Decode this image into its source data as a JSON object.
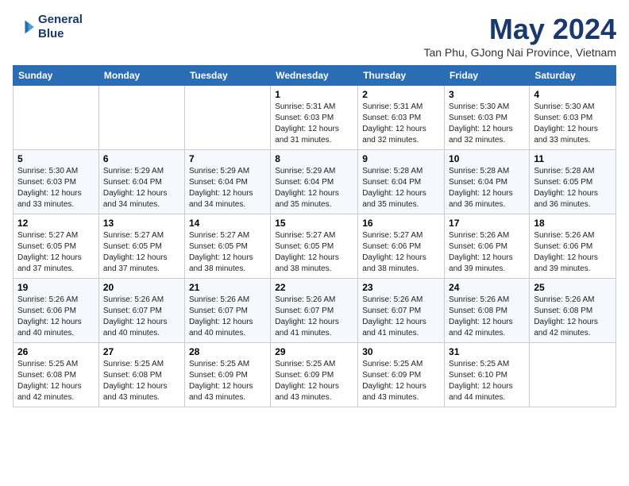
{
  "header": {
    "logo_line1": "General",
    "logo_line2": "Blue",
    "title": "May 2024",
    "subtitle": "Tan Phu, GJong Nai Province, Vietnam"
  },
  "weekdays": [
    "Sunday",
    "Monday",
    "Tuesday",
    "Wednesday",
    "Thursday",
    "Friday",
    "Saturday"
  ],
  "weeks": [
    [
      {
        "day": "",
        "info": ""
      },
      {
        "day": "",
        "info": ""
      },
      {
        "day": "",
        "info": ""
      },
      {
        "day": "1",
        "info": "Sunrise: 5:31 AM\nSunset: 6:03 PM\nDaylight: 12 hours\nand 31 minutes."
      },
      {
        "day": "2",
        "info": "Sunrise: 5:31 AM\nSunset: 6:03 PM\nDaylight: 12 hours\nand 32 minutes."
      },
      {
        "day": "3",
        "info": "Sunrise: 5:30 AM\nSunset: 6:03 PM\nDaylight: 12 hours\nand 32 minutes."
      },
      {
        "day": "4",
        "info": "Sunrise: 5:30 AM\nSunset: 6:03 PM\nDaylight: 12 hours\nand 33 minutes."
      }
    ],
    [
      {
        "day": "5",
        "info": "Sunrise: 5:30 AM\nSunset: 6:03 PM\nDaylight: 12 hours\nand 33 minutes."
      },
      {
        "day": "6",
        "info": "Sunrise: 5:29 AM\nSunset: 6:04 PM\nDaylight: 12 hours\nand 34 minutes."
      },
      {
        "day": "7",
        "info": "Sunrise: 5:29 AM\nSunset: 6:04 PM\nDaylight: 12 hours\nand 34 minutes."
      },
      {
        "day": "8",
        "info": "Sunrise: 5:29 AM\nSunset: 6:04 PM\nDaylight: 12 hours\nand 35 minutes."
      },
      {
        "day": "9",
        "info": "Sunrise: 5:28 AM\nSunset: 6:04 PM\nDaylight: 12 hours\nand 35 minutes."
      },
      {
        "day": "10",
        "info": "Sunrise: 5:28 AM\nSunset: 6:04 PM\nDaylight: 12 hours\nand 36 minutes."
      },
      {
        "day": "11",
        "info": "Sunrise: 5:28 AM\nSunset: 6:05 PM\nDaylight: 12 hours\nand 36 minutes."
      }
    ],
    [
      {
        "day": "12",
        "info": "Sunrise: 5:27 AM\nSunset: 6:05 PM\nDaylight: 12 hours\nand 37 minutes."
      },
      {
        "day": "13",
        "info": "Sunrise: 5:27 AM\nSunset: 6:05 PM\nDaylight: 12 hours\nand 37 minutes."
      },
      {
        "day": "14",
        "info": "Sunrise: 5:27 AM\nSunset: 6:05 PM\nDaylight: 12 hours\nand 38 minutes."
      },
      {
        "day": "15",
        "info": "Sunrise: 5:27 AM\nSunset: 6:05 PM\nDaylight: 12 hours\nand 38 minutes."
      },
      {
        "day": "16",
        "info": "Sunrise: 5:27 AM\nSunset: 6:06 PM\nDaylight: 12 hours\nand 38 minutes."
      },
      {
        "day": "17",
        "info": "Sunrise: 5:26 AM\nSunset: 6:06 PM\nDaylight: 12 hours\nand 39 minutes."
      },
      {
        "day": "18",
        "info": "Sunrise: 5:26 AM\nSunset: 6:06 PM\nDaylight: 12 hours\nand 39 minutes."
      }
    ],
    [
      {
        "day": "19",
        "info": "Sunrise: 5:26 AM\nSunset: 6:06 PM\nDaylight: 12 hours\nand 40 minutes."
      },
      {
        "day": "20",
        "info": "Sunrise: 5:26 AM\nSunset: 6:07 PM\nDaylight: 12 hours\nand 40 minutes."
      },
      {
        "day": "21",
        "info": "Sunrise: 5:26 AM\nSunset: 6:07 PM\nDaylight: 12 hours\nand 40 minutes."
      },
      {
        "day": "22",
        "info": "Sunrise: 5:26 AM\nSunset: 6:07 PM\nDaylight: 12 hours\nand 41 minutes."
      },
      {
        "day": "23",
        "info": "Sunrise: 5:26 AM\nSunset: 6:07 PM\nDaylight: 12 hours\nand 41 minutes."
      },
      {
        "day": "24",
        "info": "Sunrise: 5:26 AM\nSunset: 6:08 PM\nDaylight: 12 hours\nand 42 minutes."
      },
      {
        "day": "25",
        "info": "Sunrise: 5:26 AM\nSunset: 6:08 PM\nDaylight: 12 hours\nand 42 minutes."
      }
    ],
    [
      {
        "day": "26",
        "info": "Sunrise: 5:25 AM\nSunset: 6:08 PM\nDaylight: 12 hours\nand 42 minutes."
      },
      {
        "day": "27",
        "info": "Sunrise: 5:25 AM\nSunset: 6:08 PM\nDaylight: 12 hours\nand 43 minutes."
      },
      {
        "day": "28",
        "info": "Sunrise: 5:25 AM\nSunset: 6:09 PM\nDaylight: 12 hours\nand 43 minutes."
      },
      {
        "day": "29",
        "info": "Sunrise: 5:25 AM\nSunset: 6:09 PM\nDaylight: 12 hours\nand 43 minutes."
      },
      {
        "day": "30",
        "info": "Sunrise: 5:25 AM\nSunset: 6:09 PM\nDaylight: 12 hours\nand 43 minutes."
      },
      {
        "day": "31",
        "info": "Sunrise: 5:25 AM\nSunset: 6:10 PM\nDaylight: 12 hours\nand 44 minutes."
      },
      {
        "day": "",
        "info": ""
      }
    ]
  ]
}
